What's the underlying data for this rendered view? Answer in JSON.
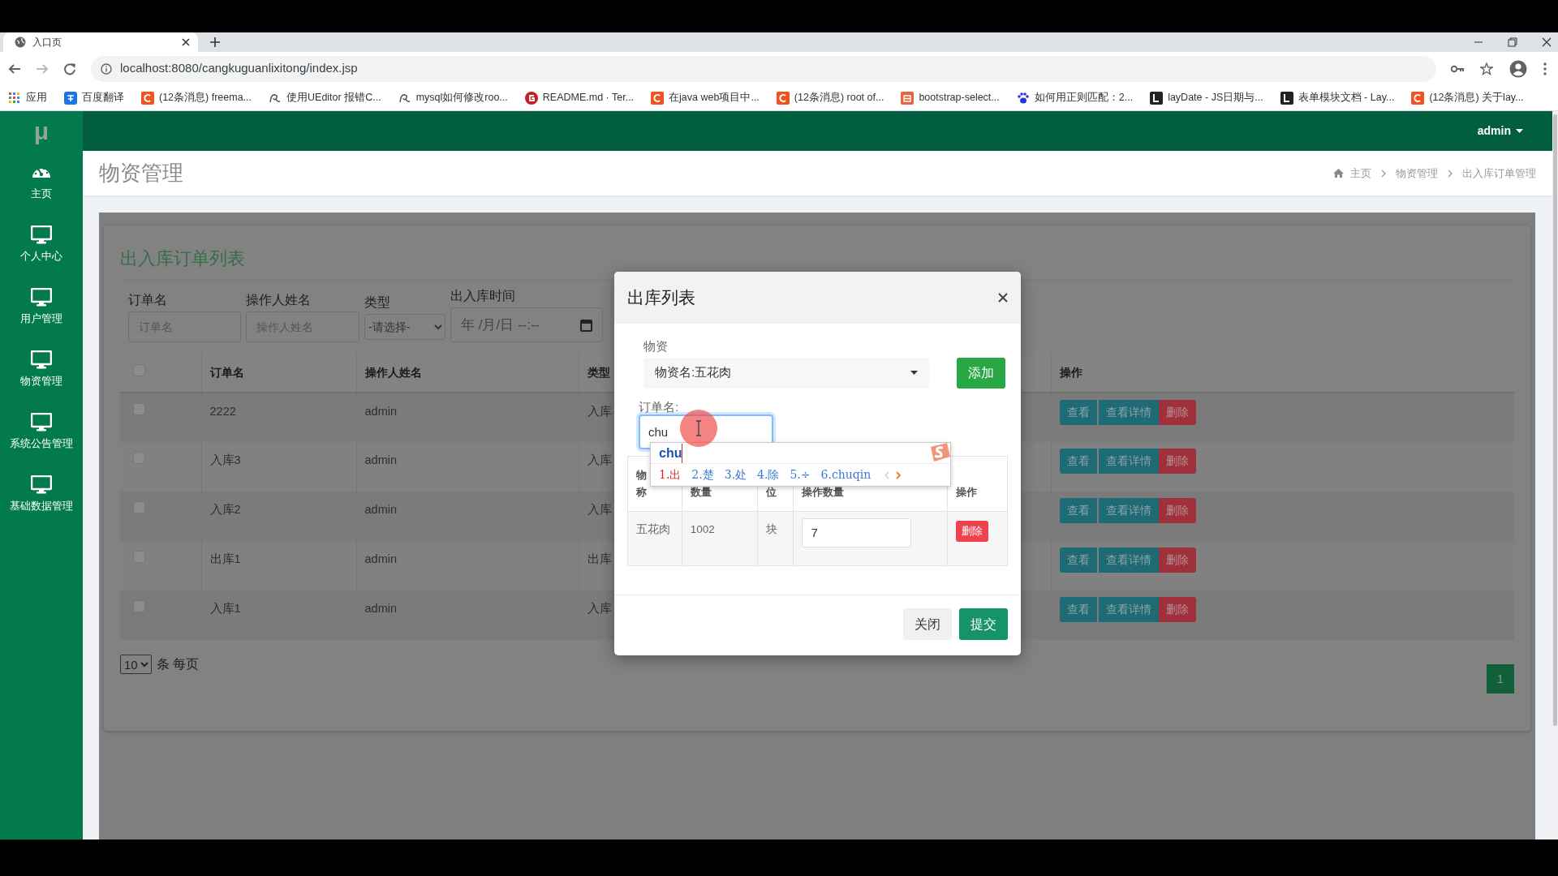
{
  "browser": {
    "tab": {
      "title": "入口页"
    },
    "url": "localhost:8080/cangkuguanlixitong/index.jsp",
    "bookmarks": [
      {
        "label": "应用",
        "kind": "apps"
      },
      {
        "label": "百度翻译",
        "kind": "translate"
      },
      {
        "label": "(12条消息) freema...",
        "kind": "csdn"
      },
      {
        "label": "使用UEditor 报错C...",
        "kind": "ueditor"
      },
      {
        "label": "mysql如何修改roo...",
        "kind": "ueditor"
      },
      {
        "label": "README.md · Ter...",
        "kind": "gitee"
      },
      {
        "label": "在java web项目中...",
        "kind": "csdn"
      },
      {
        "label": "(12条消息) root of...",
        "kind": "csdn"
      },
      {
        "label": "bootstrap-select...",
        "kind": "jian"
      },
      {
        "label": "如何用正则匹配：2...",
        "kind": "baidu"
      },
      {
        "label": "layDate - JS日期与...",
        "kind": "layui"
      },
      {
        "label": "表单模块文档 - Lay...",
        "kind": "layui"
      },
      {
        "label": "(12条消息) 关于lay...",
        "kind": "csdn"
      }
    ]
  },
  "app": {
    "logo": "μ",
    "user": "admin",
    "sidebar": [
      {
        "label": "主页",
        "kind": "dashboard"
      },
      {
        "label": "个人中心",
        "kind": "monitor"
      },
      {
        "label": "用户管理",
        "kind": "monitor"
      },
      {
        "label": "物资管理",
        "kind": "monitor"
      },
      {
        "label": "系统公告管理",
        "kind": "monitor"
      },
      {
        "label": "基础数据管理",
        "kind": "monitor"
      }
    ]
  },
  "page": {
    "title": "物资管理",
    "breadcrumb": [
      "主页",
      "物资管理",
      "出入库订单管理"
    ]
  },
  "card": {
    "title": "出入库订单列表",
    "filters": [
      {
        "label": "订单名",
        "kind": "text",
        "placeholder": "订单名"
      },
      {
        "label": "操作人姓名",
        "kind": "text",
        "placeholder": "操作人姓名"
      },
      {
        "label": "类型",
        "kind": "select",
        "value": "-请选择-"
      },
      {
        "label": "出入库时间",
        "kind": "datetime",
        "value": "年 /月/日 --:--"
      }
    ],
    "table": {
      "select_all_checked": false,
      "columns": [
        "订单名",
        "操作人姓名",
        "类型",
        "操作"
      ],
      "rows": [
        {
          "checked": false,
          "cells": [
            "2222",
            "admin",
            "入库"
          ],
          "actions": [
            {
              "label": "查看",
              "kind": "info"
            },
            {
              "label": "查看详情",
              "kind": "info"
            },
            {
              "label": "删除",
              "kind": "danger"
            }
          ]
        },
        {
          "checked": false,
          "cells": [
            "入库3",
            "admin",
            "入库"
          ],
          "actions": [
            {
              "label": "查看",
              "kind": "info"
            },
            {
              "label": "查看详情",
              "kind": "info"
            },
            {
              "label": "删除",
              "kind": "danger"
            }
          ]
        },
        {
          "checked": false,
          "cells": [
            "入库2",
            "admin",
            "入库"
          ],
          "actions": [
            {
              "label": "查看",
              "kind": "info"
            },
            {
              "label": "查看详情",
              "kind": "info"
            },
            {
              "label": "删除",
              "kind": "danger"
            }
          ]
        },
        {
          "checked": false,
          "cells": [
            "出库1",
            "admin",
            "出库"
          ],
          "actions": [
            {
              "label": "查看",
              "kind": "info"
            },
            {
              "label": "查看详情",
              "kind": "info"
            },
            {
              "label": "删除",
              "kind": "danger"
            }
          ]
        },
        {
          "checked": false,
          "cells": [
            "入库1",
            "admin",
            "入库"
          ],
          "actions": [
            {
              "label": "查看",
              "kind": "info"
            },
            {
              "label": "查看详情",
              "kind": "info"
            },
            {
              "label": "删除",
              "kind": "danger"
            }
          ]
        }
      ]
    },
    "page_size": "10",
    "page_size_label": "条 每页",
    "pages": [
      {
        "label": "1",
        "selected": true
      }
    ]
  },
  "modal": {
    "title": "出库列表",
    "material_label": "物资",
    "material_value": "物资名:五花肉",
    "add_button": "添加",
    "order_label": "订单名:",
    "order_value": "chu",
    "table": {
      "columns": [
        {
          "top": "物",
          "bottom": "称"
        },
        {
          "bottom": "数量"
        },
        {
          "bottom": "位"
        },
        {
          "bottom": "操作数量"
        },
        {
          "bottom": "操作"
        }
      ],
      "rows": [
        {
          "cells": [
            "五花肉",
            "1002",
            "块"
          ],
          "quantity": "7",
          "action": "删除"
        }
      ]
    },
    "buttons": [
      {
        "label": "关闭",
        "kind": "secondary"
      },
      {
        "label": "提交",
        "kind": "primary"
      }
    ]
  },
  "ime": {
    "composition": "chu",
    "candidates": [
      {
        "label": "1.出",
        "selected": true
      },
      {
        "label": "2.楚",
        "selected": false
      },
      {
        "label": "3.处",
        "selected": false
      },
      {
        "label": "4.除",
        "selected": false
      },
      {
        "label": "5.÷",
        "selected": false
      },
      {
        "label": "6.chuqin",
        "selected": false
      }
    ]
  }
}
